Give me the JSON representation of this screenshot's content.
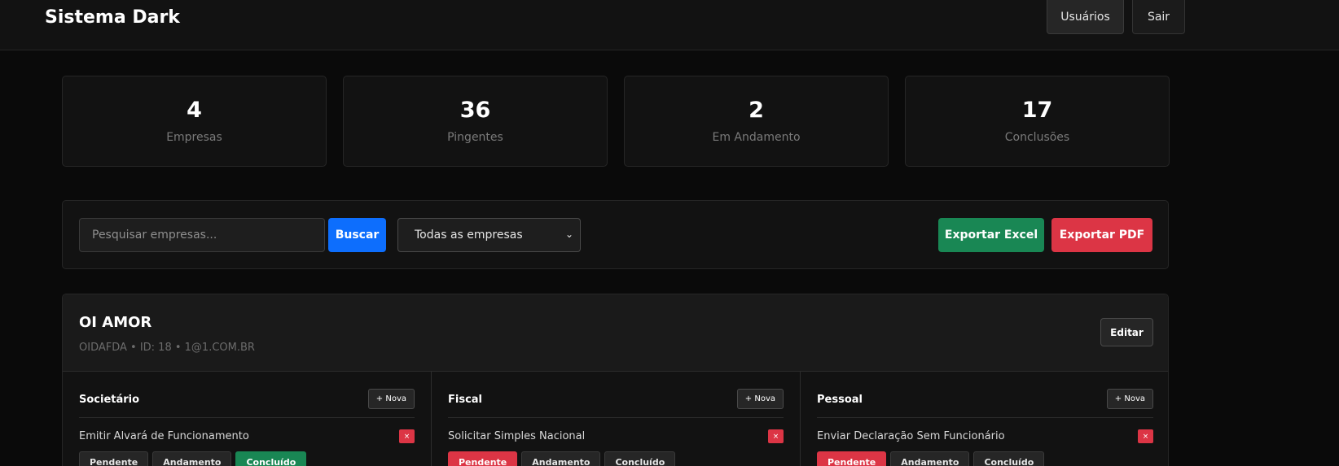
{
  "header": {
    "brand": "Sistema Dark",
    "users_label": "Usuários",
    "logout_label": "Sair"
  },
  "stats": [
    {
      "value": "4",
      "label": "Empresas"
    },
    {
      "value": "36",
      "label": "Pingentes"
    },
    {
      "value": "2",
      "label": "Em Andamento"
    },
    {
      "value": "17",
      "label": "Conclusões"
    }
  ],
  "toolbar": {
    "search_placeholder": "Pesquisar empresas...",
    "search_label": "Buscar",
    "filter_selected": "Todas as empresas",
    "export_excel": "Exportar Excel",
    "export_pdf": "Exportar PDF"
  },
  "company": {
    "name": "OI AMOR",
    "meta": "OIDAFDA • ID: 18 • 1@1.COM.BR",
    "edit_label": "Editar",
    "columns": [
      {
        "title": "Societário",
        "new_label": "+ Nova",
        "task": "Emitir Alvará de Funcionamento",
        "delete_label": "×",
        "statuses": [
          "Pendente",
          "Andamento",
          "Concluído"
        ],
        "active": "Concluído"
      },
      {
        "title": "Fiscal",
        "new_label": "+ Nova",
        "task": "Solicitar Simples Nacional",
        "delete_label": "×",
        "statuses": [
          "Pendente",
          "Andamento",
          "Concluído"
        ],
        "active": "Pendente"
      },
      {
        "title": "Pessoal",
        "new_label": "+ Nova",
        "task": "Enviar Declaração Sem Funcionário",
        "delete_label": "×",
        "statuses": [
          "Pendente",
          "Andamento",
          "Concluído"
        ],
        "active": "Pendente"
      }
    ]
  },
  "colors": {
    "primary": "#0d6efd",
    "success": "#198754",
    "danger": "#dc3545",
    "background": "#0a0a0a"
  }
}
